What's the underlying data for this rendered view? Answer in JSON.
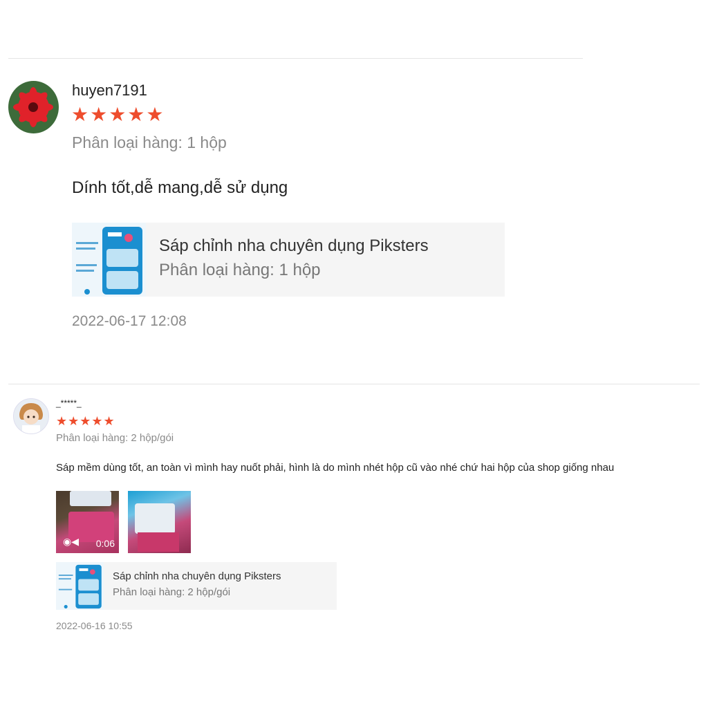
{
  "colors": {
    "star": "#ee4d2d",
    "product_bg": "#f5f5f5",
    "muted": "#8a8a8a"
  },
  "reviews": [
    {
      "username": "huyen7191",
      "stars": "★★★★★",
      "rating": 5,
      "variant": "Phân loại hàng: 1 hộp",
      "comment": "Dính tốt,dễ mang,dễ sử dụng",
      "product": {
        "name": "Sáp chỉnh nha chuyên dụng Piksters",
        "variant": "Phân loại hàng: 1 hộp"
      },
      "timestamp": "2022-06-17 12:08"
    },
    {
      "username": "_*****_",
      "stars": "★★★★★",
      "rating": 5,
      "variant": "Phân loại hàng: 2 hộp/gói",
      "comment": "Sáp mềm dùng tốt, an toàn vì mình hay nuốt phải, hình là do mình nhét hộp cũ vào nhé chứ hai hộp của shop giống nhau",
      "media": {
        "video_duration": "0:06"
      },
      "product": {
        "name": "Sáp chỉnh nha chuyên dụng Piksters",
        "variant": "Phân loại hàng: 2 hộp/gói"
      },
      "timestamp": "2022-06-16 10:55"
    }
  ]
}
